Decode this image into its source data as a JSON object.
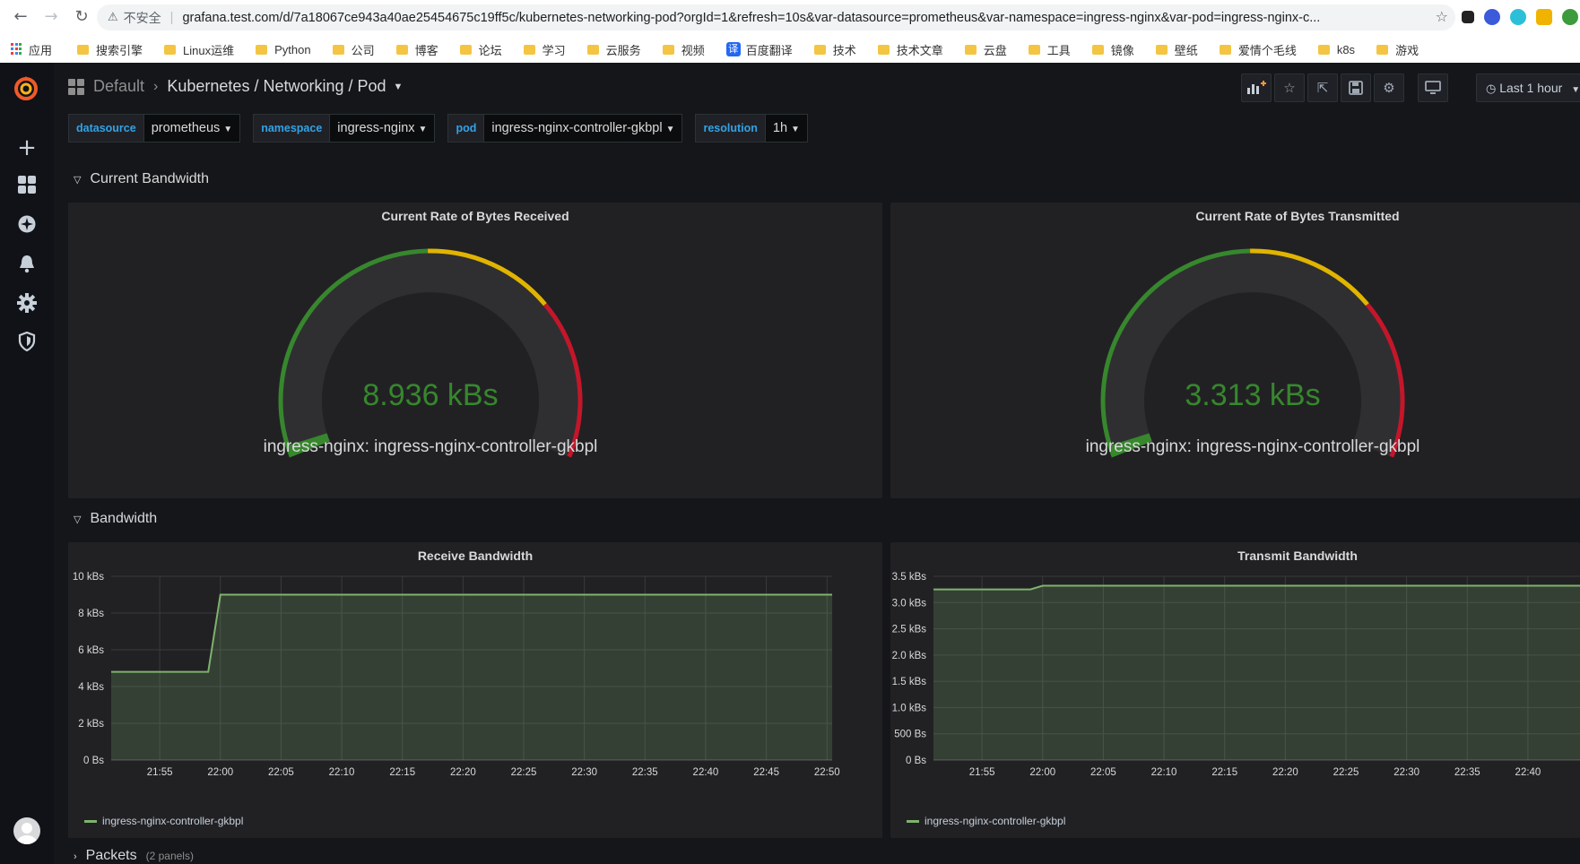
{
  "browser": {
    "insecure_label": "不安全",
    "url": "grafana.test.com/d/7a18067ce943a40ae25454675c19ff5c/kubernetes-networking-pod?orgId=1&refresh=10s&var-datasource=prometheus&var-namespace=ingress-nginx&var-pod=ingress-nginx-c...",
    "bookmarks": [
      "应用",
      "搜索引擎",
      "Linux运维",
      "Python",
      "公司",
      "博客",
      "论坛",
      "学习",
      "云服务",
      "视频",
      "百度翻译",
      "技术",
      "技术文章",
      "云盘",
      "工具",
      "镜像",
      "壁纸",
      "爱情个毛线",
      "k8s",
      "游戏"
    ],
    "fanyi_badge": "译"
  },
  "header": {
    "folder": "Default",
    "title": "Kubernetes / Networking / Pod",
    "time_range": "Last 1 hour"
  },
  "variables": [
    {
      "label": "datasource",
      "value": "prometheus"
    },
    {
      "label": "namespace",
      "value": "ingress-nginx"
    },
    {
      "label": "pod",
      "value": "ingress-nginx-controller-gkbpl"
    },
    {
      "label": "resolution",
      "value": "1h"
    }
  ],
  "rows": {
    "current_bandwidth": "Current Bandwidth",
    "bandwidth": "Bandwidth",
    "packets": "Packets",
    "packets_sub": "(2 panels)"
  },
  "gauges": [
    {
      "title": "Current Rate of Bytes Received",
      "value_text": "8.936 kBs",
      "label": "ingress-nginx: ingress-nginx-controller-gkbpl",
      "fraction": 0.02
    },
    {
      "title": "Current Rate of Bytes Transmitted",
      "value_text": "3.313 kBs",
      "label": "ingress-nginx: ingress-nginx-controller-gkbpl",
      "fraction": 0.02
    }
  ],
  "colors": {
    "green": "#37872d",
    "yellow": "#e0b400",
    "red": "#c4162a",
    "series": "#7eb26d"
  },
  "chart_data": [
    {
      "type": "area",
      "title": "Receive Bandwidth",
      "x": [
        "21:50",
        "21:59",
        "22:00",
        "22:50"
      ],
      "series": [
        {
          "name": "ingress-nginx-controller-gkbpl",
          "values": [
            4.8,
            4.8,
            9.0,
            9.0
          ]
        }
      ],
      "xticks": [
        "21:55",
        "22:00",
        "22:05",
        "22:10",
        "22:15",
        "22:20",
        "22:25",
        "22:30",
        "22:35",
        "22:40",
        "22:45",
        "22:50"
      ],
      "yticks": [
        "0 Bs",
        "2 kBs",
        "4 kBs",
        "6 kBs",
        "8 kBs",
        "10 kBs"
      ],
      "ylim": [
        0,
        10
      ],
      "grid": true,
      "legend": "bottom-left"
    },
    {
      "type": "area",
      "title": "Transmit Bandwidth",
      "x": [
        "21:50",
        "21:59",
        "22:00",
        "22:42"
      ],
      "series": [
        {
          "name": "ingress-nginx-controller-gkbpl",
          "values": [
            3.25,
            3.25,
            3.32,
            3.32
          ]
        }
      ],
      "xticks": [
        "21:55",
        "22:00",
        "22:05",
        "22:10",
        "22:15",
        "22:20",
        "22:25",
        "22:30",
        "22:35",
        "22:40"
      ],
      "yticks": [
        "0 Bs",
        "500 Bs",
        "1.0 kBs",
        "1.5 kBs",
        "2.0 kBs",
        "2.5 kBs",
        "3.0 kBs",
        "3.5 kBs"
      ],
      "ylim": [
        0,
        3.5
      ],
      "grid": true,
      "legend": "bottom-left"
    }
  ]
}
